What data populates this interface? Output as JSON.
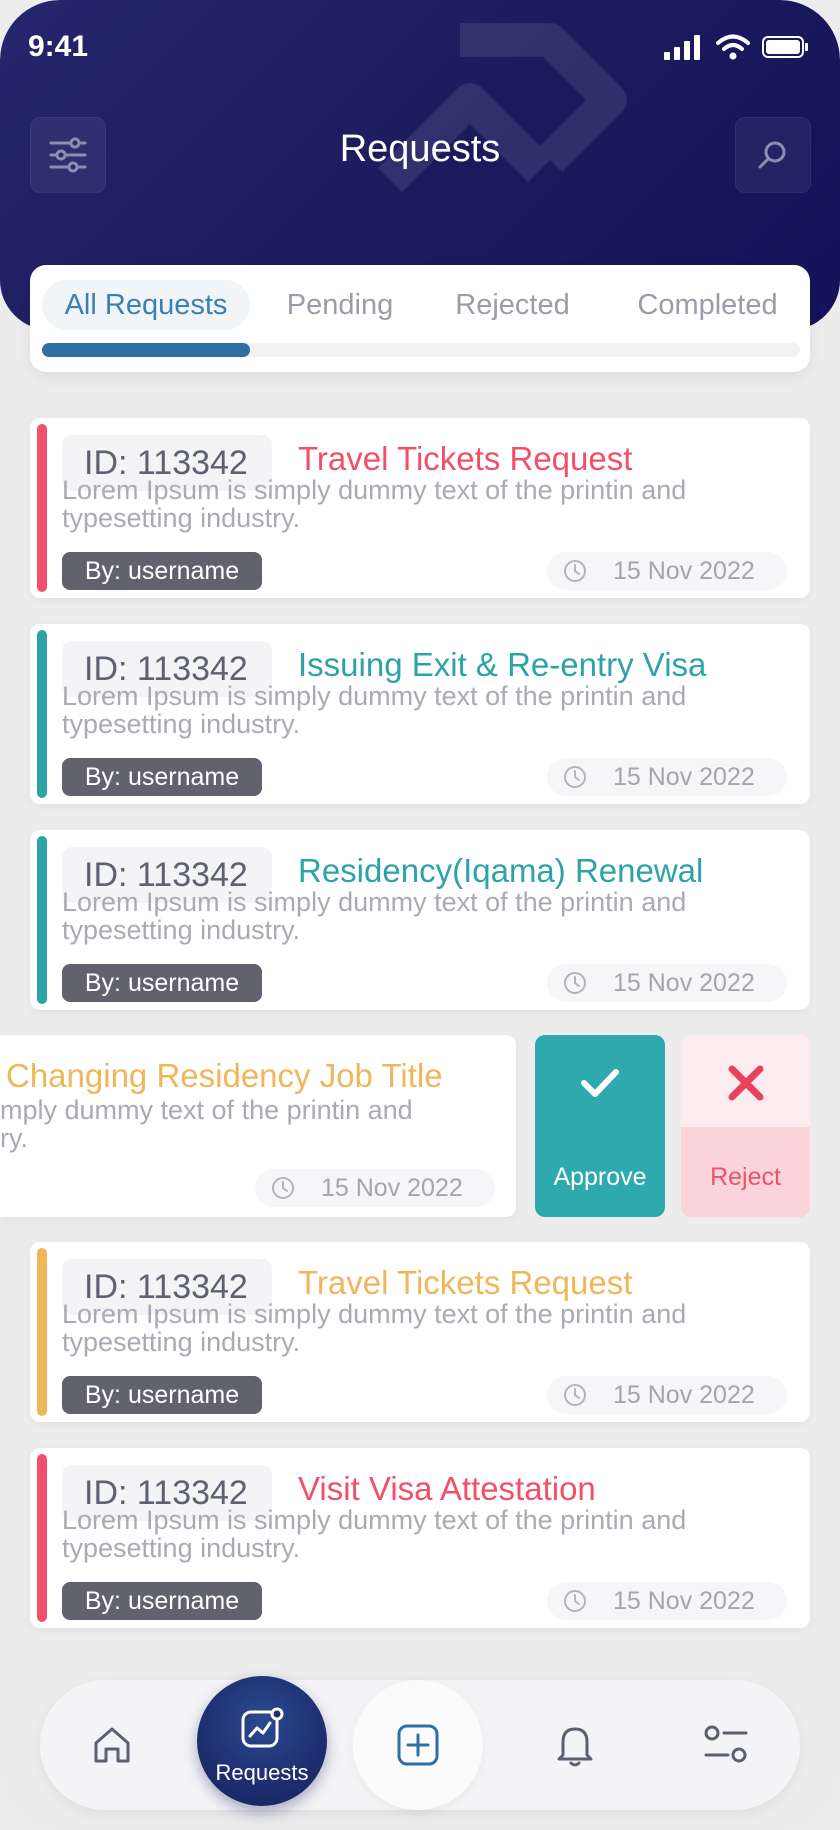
{
  "status_bar": {
    "time": "9:41"
  },
  "header": {
    "title": "Requests"
  },
  "tabs": [
    {
      "label": "All Requests",
      "active": true
    },
    {
      "label": "Pending",
      "active": false
    },
    {
      "label": "Rejected",
      "active": false
    },
    {
      "label": "Completed",
      "active": false
    }
  ],
  "colors": {
    "red": "#f2506a",
    "teal": "#2da3a8",
    "amber": "#f0b65a",
    "navy": "#1c1d60"
  },
  "requests": [
    {
      "id": "ID: 113342",
      "title": "Travel Tickets Request",
      "color": "#f2506a",
      "desc": "Lorem Ipsum is simply dummy text of the printin and typesetting industry.",
      "by": "By: username",
      "date": "15 Nov 2022"
    },
    {
      "id": "ID: 113342",
      "title": "Issuing Exit & Re-entry Visa",
      "color": "#2da3a8",
      "desc": "Lorem Ipsum is simply dummy text of the printin and typesetting industry.",
      "by": "By: username",
      "date": "15 Nov 2022"
    },
    {
      "id": "ID: 113342",
      "title": "Residency(Iqama) Renewal",
      "color": "#2da3a8",
      "desc": "Lorem Ipsum is simply dummy text of the printin and typesetting industry.",
      "by": "By: username",
      "date": "15 Nov 2022"
    },
    {
      "id": "ID: 113342",
      "title": "Travel Tickets Request",
      "color": "#f0b65a",
      "desc": "Lorem Ipsum is simply dummy text of the printin and typesetting industry.",
      "by": "By: username",
      "date": "15 Nov 2022"
    },
    {
      "id": "ID: 113342",
      "title": "Visit Visa Attestation",
      "color": "#f2506a",
      "desc": "Lorem Ipsum is simply dummy text of the printin and typesetting industry.",
      "by": "By: username",
      "date": "15 Nov 2022"
    }
  ],
  "swiped_request": {
    "title": "Changing Residency Job Title",
    "desc_line1": "mply dummy text of the printin and",
    "desc_line2": "ry.",
    "date": "15 Nov 2022",
    "approve_label": "Approve",
    "reject_label": "Reject"
  },
  "bottom_nav": {
    "active_label": "Requests",
    "items": [
      "home-icon",
      "requests-icon",
      "add-icon",
      "bell-icon",
      "settings-icon"
    ]
  }
}
